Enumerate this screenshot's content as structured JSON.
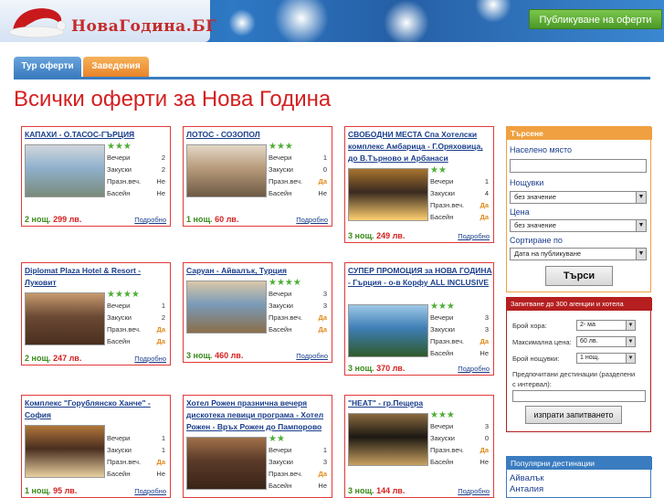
{
  "header": {
    "logo": "НоваГодина.БГ",
    "publish_button": "Публикуване на оферти"
  },
  "tabs": [
    {
      "label": "Тур оферти",
      "active": true
    },
    {
      "label": "Заведения",
      "active": false
    }
  ],
  "page_title": "Всички оферти за Нова Година",
  "row_labels": {
    "nights": "Вечери",
    "breakfasts": "Закуски",
    "holiday_dinner": "Празн.веч.",
    "pool": "Басейн"
  },
  "offers": [
    {
      "title": "КАПАХИ - О.ТАСОС-ГЪРЦИЯ",
      "stars": "★★★",
      "nights": "2",
      "breakfasts": "2",
      "dinner": "Не",
      "pool": "Не",
      "price_prefix": "2 нощ.",
      "price": "299 лв.",
      "more": "Подробно"
    },
    {
      "title": "ЛОТОС - СОЗОПОЛ",
      "stars": "★★★",
      "nights": "1",
      "breakfasts": "0",
      "dinner": "Да",
      "pool": "Не",
      "price_prefix": "1 нощ.",
      "price": "60 лв.",
      "more": "Подробно"
    },
    {
      "title": "СВОБОДНИ МЕСТА Спа Хотелски комплекс Амбарица - Г.Оряховица, до В.Търново и Арбанаси",
      "stars": "★★",
      "nights": "1",
      "breakfasts": "4",
      "dinner": "Да",
      "pool": "Да",
      "price_prefix": "3 нощ.",
      "price": "249 лв.",
      "more": "Подробно"
    },
    {
      "title": "Diplomat Plaza Hotel & Resort - Луковит",
      "stars": "★★★★",
      "nights": "1",
      "breakfasts": "2",
      "dinner": "Да",
      "pool": "Да",
      "price_prefix": "2 нощ.",
      "price": "247 лв.",
      "more": "Подробно"
    },
    {
      "title": "Саруан - Айвалък, Турция",
      "stars": "★★★★",
      "nights": "3",
      "breakfasts": "3",
      "dinner": "Да",
      "pool": "Да",
      "price_prefix": "3 нощ.",
      "price": "460 лв.",
      "more": "Подробно"
    },
    {
      "title": "СУПЕР ПРОМОЦИЯ за НОВА ГОДИНА - Гърция - о-в Корфу ALL INCLUSIVE",
      "stars": "★★★",
      "nights": "3",
      "breakfasts": "3",
      "dinner": "Да",
      "pool": "Не",
      "price_prefix": "3 нощ.",
      "price": "370 лв.",
      "more": "Подробно"
    },
    {
      "title": "Комплекс \"Горублянско Ханче\" - София",
      "stars": "",
      "nights": "1",
      "breakfasts": "1",
      "dinner": "Да",
      "pool": "Не",
      "price_prefix": "1 нощ.",
      "price": "95 лв.",
      "more": "Подробно"
    },
    {
      "title": "Хотел Рожен празнична вечеря дискотека певици програма - Хотел Рожен - Връх Рожен до Пампорово",
      "stars": "★★",
      "nights": "1",
      "breakfasts": "3",
      "dinner": "Да",
      "pool": "Не",
      "price_prefix": "",
      "price": "",
      "more": ""
    },
    {
      "title": "\"НЕАТ\" - гр.Пещера",
      "stars": "★★★",
      "nights": "3",
      "breakfasts": "0",
      "dinner": "Да",
      "pool": "Не",
      "price_prefix": "3 нощ.",
      "price": "144 лв.",
      "more": "Подробно"
    }
  ],
  "search": {
    "title": "Търсене",
    "place_label": "Населено място",
    "place_value": "",
    "nights_label": "Нощувки",
    "nights_value": "без значение",
    "price_label": "Цена",
    "price_value": "без значение",
    "sort_label": "Сортиране по",
    "sort_value": "Дата на публикуване",
    "button": "Търси"
  },
  "request": {
    "title": "Запитване до 300 агенции и хотела",
    "people_label": "Брой хора:",
    "people_value": "2- ма",
    "price_label": "Максимална цена:",
    "price_value": "60 лв.",
    "nights_label": "Брой нощувки:",
    "nights_value": "1 нощ.",
    "dest_label": "Предпочитани дестинации (разделени с интервал):",
    "dest_value": "",
    "button": "изпрати запитването"
  },
  "popular": {
    "title": "Популярни дестинации",
    "items": [
      "Айвалък",
      "Анталия"
    ]
  },
  "colors": {
    "accent_red": "#d42020",
    "link_blue": "#1a3e8c",
    "star_green": "#4fae35",
    "tab_blue": "#3a7cc0",
    "tab_orange": "#e9842a"
  }
}
